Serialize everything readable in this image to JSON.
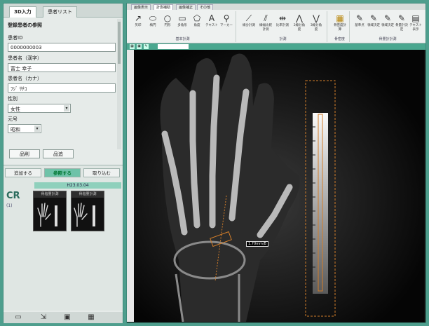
{
  "left": {
    "tabs": [
      "3D入力",
      "患者リスト"
    ],
    "form_title": "登録患者の参照",
    "fields": [
      {
        "label": "患者ID",
        "value": "0000000003"
      },
      {
        "label": "患者名（漢字）",
        "value": "富士 幸子"
      },
      {
        "label": "患者名（カナ）",
        "value": "ﾌｼﾞ ｻﾁｺ"
      }
    ],
    "sex": {
      "label": "性別",
      "value": "女性"
    },
    "era": {
      "label": "元号",
      "value": "昭和"
    },
    "buttons": [
      "品削",
      "品追"
    ]
  },
  "study": {
    "tabs": [
      "追加する",
      "参照する",
      "取り込む"
    ],
    "date": "H23.03.04",
    "modality": "CR",
    "modality_sub": "(1)",
    "thumbnails": [
      "骨塩量計測",
      "骨塩量計測"
    ]
  },
  "bottom_icons": [
    "monitor-icon",
    "import-icon",
    "delete-icon",
    "grid-icon"
  ],
  "ribbon": {
    "tabs": [
      "画像表示",
      "計測補助",
      "画像補正",
      "その他"
    ],
    "groups": [
      {
        "label": "基本計測",
        "tools": [
          "矢印",
          "楕円",
          "円形",
          "多角形",
          "角度",
          "テキスト",
          "マーカー"
        ]
      },
      {
        "label": "計測",
        "tools": [
          "線分計測",
          "線幅比較計測",
          "比率計測",
          "2線分角度",
          "3線分角度"
        ]
      },
      {
        "label": "骨密度",
        "tools": [
          "骨密度計算"
        ]
      },
      {
        "label": "骨量計計測",
        "tools": [
          "基準点",
          "領域決定",
          "領域決定",
          "骨量計決定",
          "テキスト表示"
        ]
      }
    ]
  },
  "viewer": {
    "measurement_label": "1.70mm/B",
    "roi_color": "#d17d2a"
  }
}
